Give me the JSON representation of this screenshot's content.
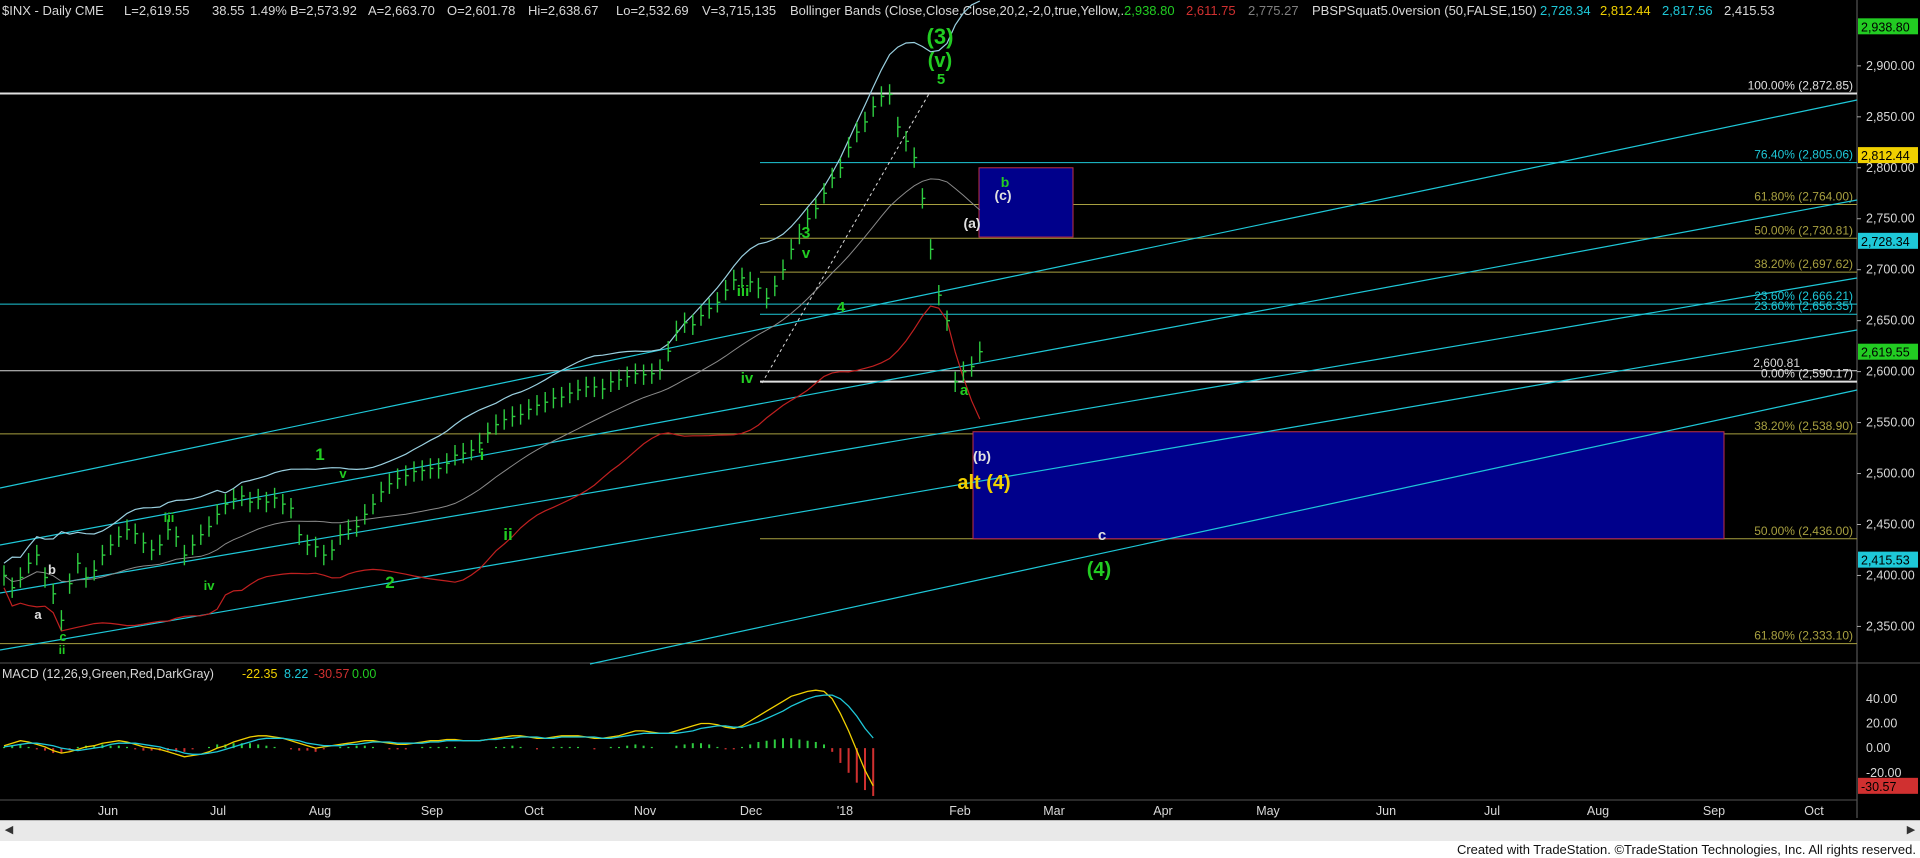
{
  "header": {
    "symbol": "$INX - Daily  CME",
    "last": "L=2,619.55",
    "change": "38.55",
    "pct": "1.49%",
    "bid": "B=2,573.92",
    "ask": "A=2,663.70",
    "open": "O=2,601.78",
    "high": "Hi=2,638.67",
    "low": "Lo=2,532.69",
    "volume": "V=3,715,135",
    "bb_label": "Bollinger Bands (Close,Close,Close,20,2,-2,0,true,Yellow,...",
    "bb_v1": "2,938.80",
    "bb_v2": "2,611.75",
    "bb_v3": "2,775.27",
    "pbs_label": "PBSPSquat5.0version (50,FALSE,150)",
    "pbs_v1": "2,728.34",
    "pbs_v2": "2,812.44",
    "pbs_v3": "2,817.56",
    "pbs_v4": "2,415.53"
  },
  "macd_header": {
    "label": "MACD (12,26,9,Green,Red,DarkGray)",
    "v1": "-22.35",
    "v2": "8.22",
    "v3": "-30.57",
    "v4": "0.00"
  },
  "x_axis": [
    "Jun",
    "Jul",
    "Aug",
    "Sep",
    "Oct",
    "Nov",
    "Dec",
    "'18",
    "Feb",
    "Mar",
    "Apr",
    "May",
    "Jun",
    "Jul",
    "Aug",
    "Sep",
    "Oct"
  ],
  "footer": {
    "credit": "Created with TradeStation. ©TradeStation Technologies, Inc. All rights reserved."
  },
  "colors": {
    "wave_green": "#22cc22",
    "cyan": "#1ec8d8",
    "fib_olive": "#a8a040",
    "yellow": "#f0d000",
    "box_blue": "#00008b",
    "box_border": "#c0304a"
  },
  "chart_data": [
    {
      "type": "line",
      "title": "$INX - Daily CME",
      "price_axis_ticks": [
        "2,900.00",
        "2,850.00",
        "2,800.00",
        "2,750.00",
        "2,700.00",
        "2,650.00",
        "2,600.00",
        "2,550.00",
        "2,500.00",
        "2,450.00",
        "2,400.00",
        "2,350.00"
      ],
      "ylim": [
        2320,
        2945
      ],
      "price_markers": [
        {
          "label": "2,938.80",
          "value": 2938.8,
          "color": "#22cc22"
        },
        {
          "label": "2,812.44",
          "value": 2812.44,
          "color": "#f0d000"
        },
        {
          "label": "2,728.34",
          "value": 2728.34,
          "color": "#1ec8d8"
        },
        {
          "label": "2,619.55",
          "value": 2619.55,
          "color": "#22cc22"
        },
        {
          "label": "2,415.53",
          "value": 2415.53,
          "color": "#1ec8d8"
        }
      ],
      "fibonacci_levels": [
        {
          "label": "100.00% (2,872.85)",
          "value": 2872.85,
          "color": "#e0e0e0"
        },
        {
          "label": "76.40% (2,805.06)",
          "value": 2805.06,
          "color": "#1ec8d8"
        },
        {
          "label": "61.80% (2,764.00)",
          "value": 2764.0,
          "color": "#a8a040"
        },
        {
          "label": "50.00% (2,730.81)",
          "value": 2730.81,
          "color": "#a8a040"
        },
        {
          "label": "38.20% (2,697.62)",
          "value": 2697.62,
          "color": "#a8a040"
        },
        {
          "label": "23.60% (2,666.21)",
          "value": 2666.21,
          "color": "#1ec8d8"
        },
        {
          "label": "23.60% (2,656.35)",
          "value": 2656.35,
          "color": "#1ec8d8"
        },
        {
          "label": "0.00% (2,590.17)",
          "value": 2590.17,
          "color": "#e0e0e0"
        },
        {
          "label": "38.20% (2,538.90)",
          "value": 2538.9,
          "color": "#a8a040"
        },
        {
          "label": "50.00% (2,436.00)",
          "value": 2436.0,
          "color": "#a8a040"
        },
        {
          "label": "61.80% (2,333.10)",
          "value": 2333.1,
          "color": "#a8a040"
        }
      ],
      "level_labels": [
        {
          "label": "2,600.81",
          "value": 2600.81
        }
      ],
      "wave_labels": [
        {
          "text": "(3)",
          "color": "#22cc22"
        },
        {
          "text": "(v)",
          "color": "#22cc22"
        },
        {
          "text": "5",
          "color": "#22cc22"
        },
        {
          "text": "3",
          "color": "#22cc22"
        },
        {
          "text": "v",
          "color": "#22cc22"
        },
        {
          "text": "iii",
          "color": "#22cc22"
        },
        {
          "text": "4",
          "color": "#22cc22"
        },
        {
          "text": "iv",
          "color": "#22cc22"
        },
        {
          "text": "1",
          "color": "#22cc22"
        },
        {
          "text": "v",
          "color": "#22cc22"
        },
        {
          "text": "i",
          "color": "#22cc22"
        },
        {
          "text": "ii",
          "color": "#22cc22"
        },
        {
          "text": "iii",
          "color": "#22cc22"
        },
        {
          "text": "iv",
          "color": "#22cc22"
        },
        {
          "text": "2",
          "color": "#22cc22"
        },
        {
          "text": "ii",
          "color": "#22cc22"
        },
        {
          "text": "a",
          "color": "#22cc22"
        },
        {
          "text": "b",
          "color": "#22cc22"
        },
        {
          "text": "c",
          "color": "#22cc22"
        },
        {
          "text": "(4)",
          "color": "#22cc22"
        },
        {
          "text": "(a)",
          "color": "#e0e0e0"
        },
        {
          "text": "(c)",
          "color": "#e0e0e0"
        },
        {
          "text": "(b)",
          "color": "#e0e0e0"
        },
        {
          "text": "b",
          "color": "#e0e0e0"
        },
        {
          "text": "a",
          "color": "#e0e0e0"
        },
        {
          "text": "c",
          "color": "#e0e0e0"
        },
        {
          "text": "alt (4)",
          "color": "#f0d000"
        }
      ],
      "target_boxes": [
        {
          "name": "b-wave box",
          "y_top": 2800,
          "y_bottom": 2732
        },
        {
          "name": "(4) support box",
          "y_top": 2541,
          "y_bottom": 2436
        }
      ],
      "close_series": [
        2400,
        2388,
        2398,
        2412,
        2420,
        2398,
        2382,
        2356,
        2392,
        2412,
        2398,
        2405,
        2420,
        2430,
        2438,
        2445,
        2441,
        2432,
        2425,
        2430,
        2445,
        2438,
        2420,
        2430,
        2440,
        2448,
        2460,
        2470,
        2475,
        2478,
        2472,
        2475,
        2472,
        2476,
        2470,
        2466,
        2440,
        2430,
        2428,
        2420,
        2425,
        2440,
        2445,
        2448,
        2460,
        2470,
        2482,
        2490,
        2495,
        2498,
        2502,
        2503,
        2505,
        2505,
        2510,
        2518,
        2520,
        2523,
        2530,
        2540,
        2548,
        2553,
        2556,
        2558,
        2563,
        2567,
        2570,
        2574,
        2575,
        2579,
        2582,
        2585,
        2585,
        2583,
        2590,
        2592,
        2595,
        2598,
        2597,
        2598,
        2602,
        2620,
        2640,
        2648,
        2646,
        2655,
        2662,
        2668,
        2680,
        2690,
        2692,
        2688,
        2682,
        2672,
        2684,
        2700,
        2720,
        2735,
        2750,
        2760,
        2775,
        2790,
        2800,
        2820,
        2835,
        2845,
        2860,
        2870,
        2872,
        2840,
        2826,
        2810,
        2770,
        2720,
        2675,
        2650,
        2590,
        2600,
        2605,
        2619.55
      ]
    },
    {
      "type": "line",
      "title": "MACD (12,26,9,Green,Red,DarkGray)",
      "axis_ticks": [
        "40.00",
        "20.00",
        "0.00",
        "-20.00"
      ],
      "ylim": [
        -38,
        52
      ],
      "marker": {
        "label": "-30.57",
        "value": -30.57
      },
      "series": [
        {
          "name": "MACD",
          "color": "#f0d000",
          "values": [
            2,
            4,
            6,
            5,
            3,
            1,
            -2,
            -4,
            -3,
            -1,
            1,
            2,
            4,
            5,
            6,
            5,
            3,
            1,
            0,
            -1,
            -3,
            -5,
            -7,
            -6,
            -5,
            -3,
            0,
            2,
            5,
            7,
            9,
            10,
            10,
            9,
            8,
            6,
            4,
            2,
            0,
            1,
            2,
            3,
            4,
            5,
            6,
            6,
            5,
            4,
            3,
            3,
            4,
            5,
            6,
            6,
            7,
            7,
            6,
            6,
            6,
            7,
            8,
            9,
            10,
            10,
            9,
            8,
            8,
            9,
            10,
            10,
            10,
            9,
            8,
            8,
            9,
            10,
            12,
            14,
            14,
            13,
            12,
            12,
            14,
            16,
            18,
            20,
            20,
            19,
            17,
            16,
            18,
            22,
            26,
            30,
            34,
            38,
            42,
            44,
            46,
            47,
            46,
            40,
            28,
            14,
            -2,
            -18,
            -30.57
          ]
        },
        {
          "name": "Signal",
          "color": "#1ec8d8",
          "values": [
            1,
            2,
            3,
            4,
            4,
            3,
            2,
            0,
            -1,
            -2,
            -1,
            0,
            1,
            3,
            4,
            4,
            4,
            3,
            2,
            1,
            -1,
            -2,
            -4,
            -5,
            -5,
            -4,
            -3,
            -1,
            1,
            3,
            5,
            7,
            8,
            8,
            8,
            7,
            6,
            4,
            3,
            2,
            2,
            2,
            3,
            3,
            4,
            5,
            5,
            5,
            4,
            4,
            4,
            4,
            5,
            5,
            6,
            6,
            6,
            6,
            6,
            7,
            7,
            8,
            8,
            9,
            9,
            9,
            8,
            8,
            9,
            9,
            9,
            9,
            9,
            8,
            8,
            9,
            10,
            11,
            12,
            12,
            12,
            12,
            12,
            13,
            14,
            16,
            17,
            18,
            18,
            17,
            17,
            19,
            21,
            24,
            27,
            30,
            34,
            37,
            40,
            42,
            43,
            43,
            40,
            34,
            26,
            16,
            8.22
          ]
        }
      ]
    }
  ]
}
